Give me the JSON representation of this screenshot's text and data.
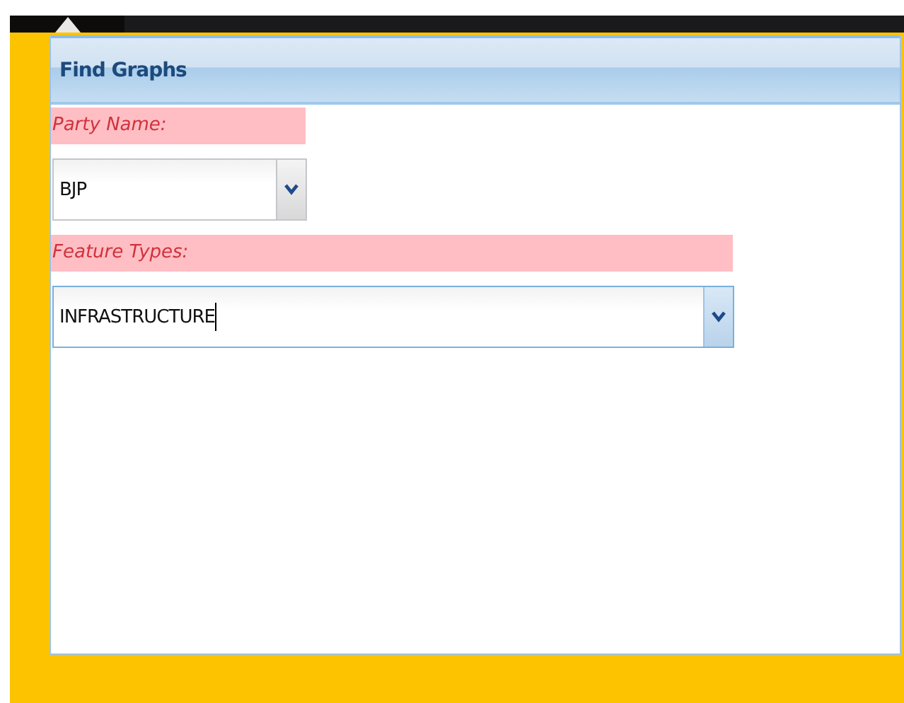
{
  "panel": {
    "title": "Find Graphs"
  },
  "fields": [
    {
      "label": "Party Name:",
      "value": "BJP",
      "focused": false
    },
    {
      "label": "Feature Types:",
      "value": "INFRASTRUCTURE",
      "focused": true
    }
  ]
}
